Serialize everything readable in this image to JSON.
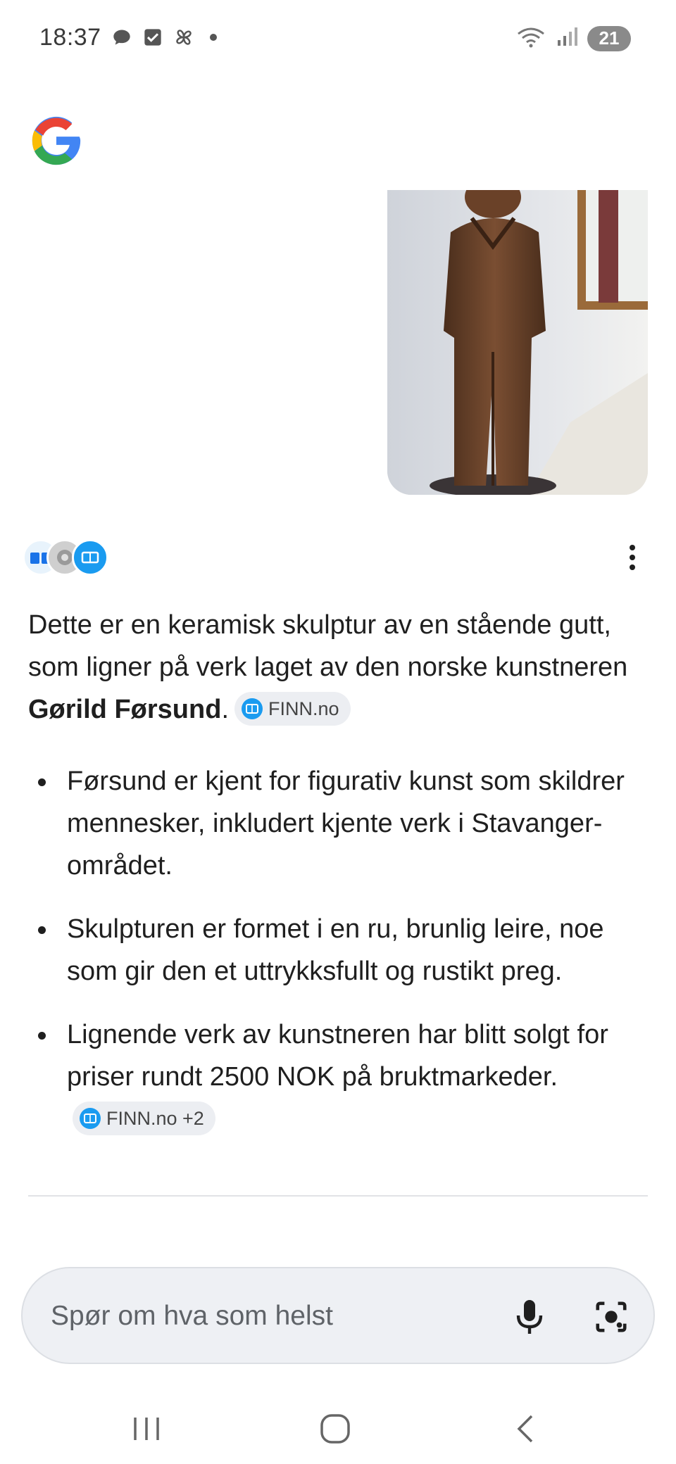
{
  "status_bar": {
    "time": "18:37",
    "battery": "21",
    "icons_left": [
      "chat-bubble-icon",
      "checkbox-icon",
      "pinwheel-icon",
      "dot-icon"
    ],
    "icons_right": [
      "wifi-icon",
      "signal-icon",
      "battery-icon"
    ]
  },
  "app": {
    "logo": "google-g-logo"
  },
  "image": {
    "description_icon": "sculpture-photo"
  },
  "answer": {
    "intro_before": "Dette er en keramisk skulptur av en stående gutt, som ligner på verk laget av den norske kunstneren ",
    "artist": "Gørild Førsund",
    "intro_after": ".",
    "intro_chip": "FINN.no",
    "bullets": [
      {
        "text": "Førsund er kjent for figurativ kunst som skildrer mennesker, inkludert kjente verk i Stavanger-området.",
        "chip": ""
      },
      {
        "text": "Skulpturen er formet i en ru, brunlig leire, noe som gir den et uttrykksfullt og rustikt preg.",
        "chip": ""
      },
      {
        "text": "Lignende verk av kunstneren har blitt solgt for priser rundt 2500 NOK på bruktmarkeder.",
        "chip": "FINN.no +2"
      }
    ]
  },
  "search": {
    "placeholder": "Spør om hva som helst"
  },
  "colors": {
    "accent": "#1a73e8",
    "chip_bg": "#eceef2",
    "search_bg": "#eef0f4"
  }
}
